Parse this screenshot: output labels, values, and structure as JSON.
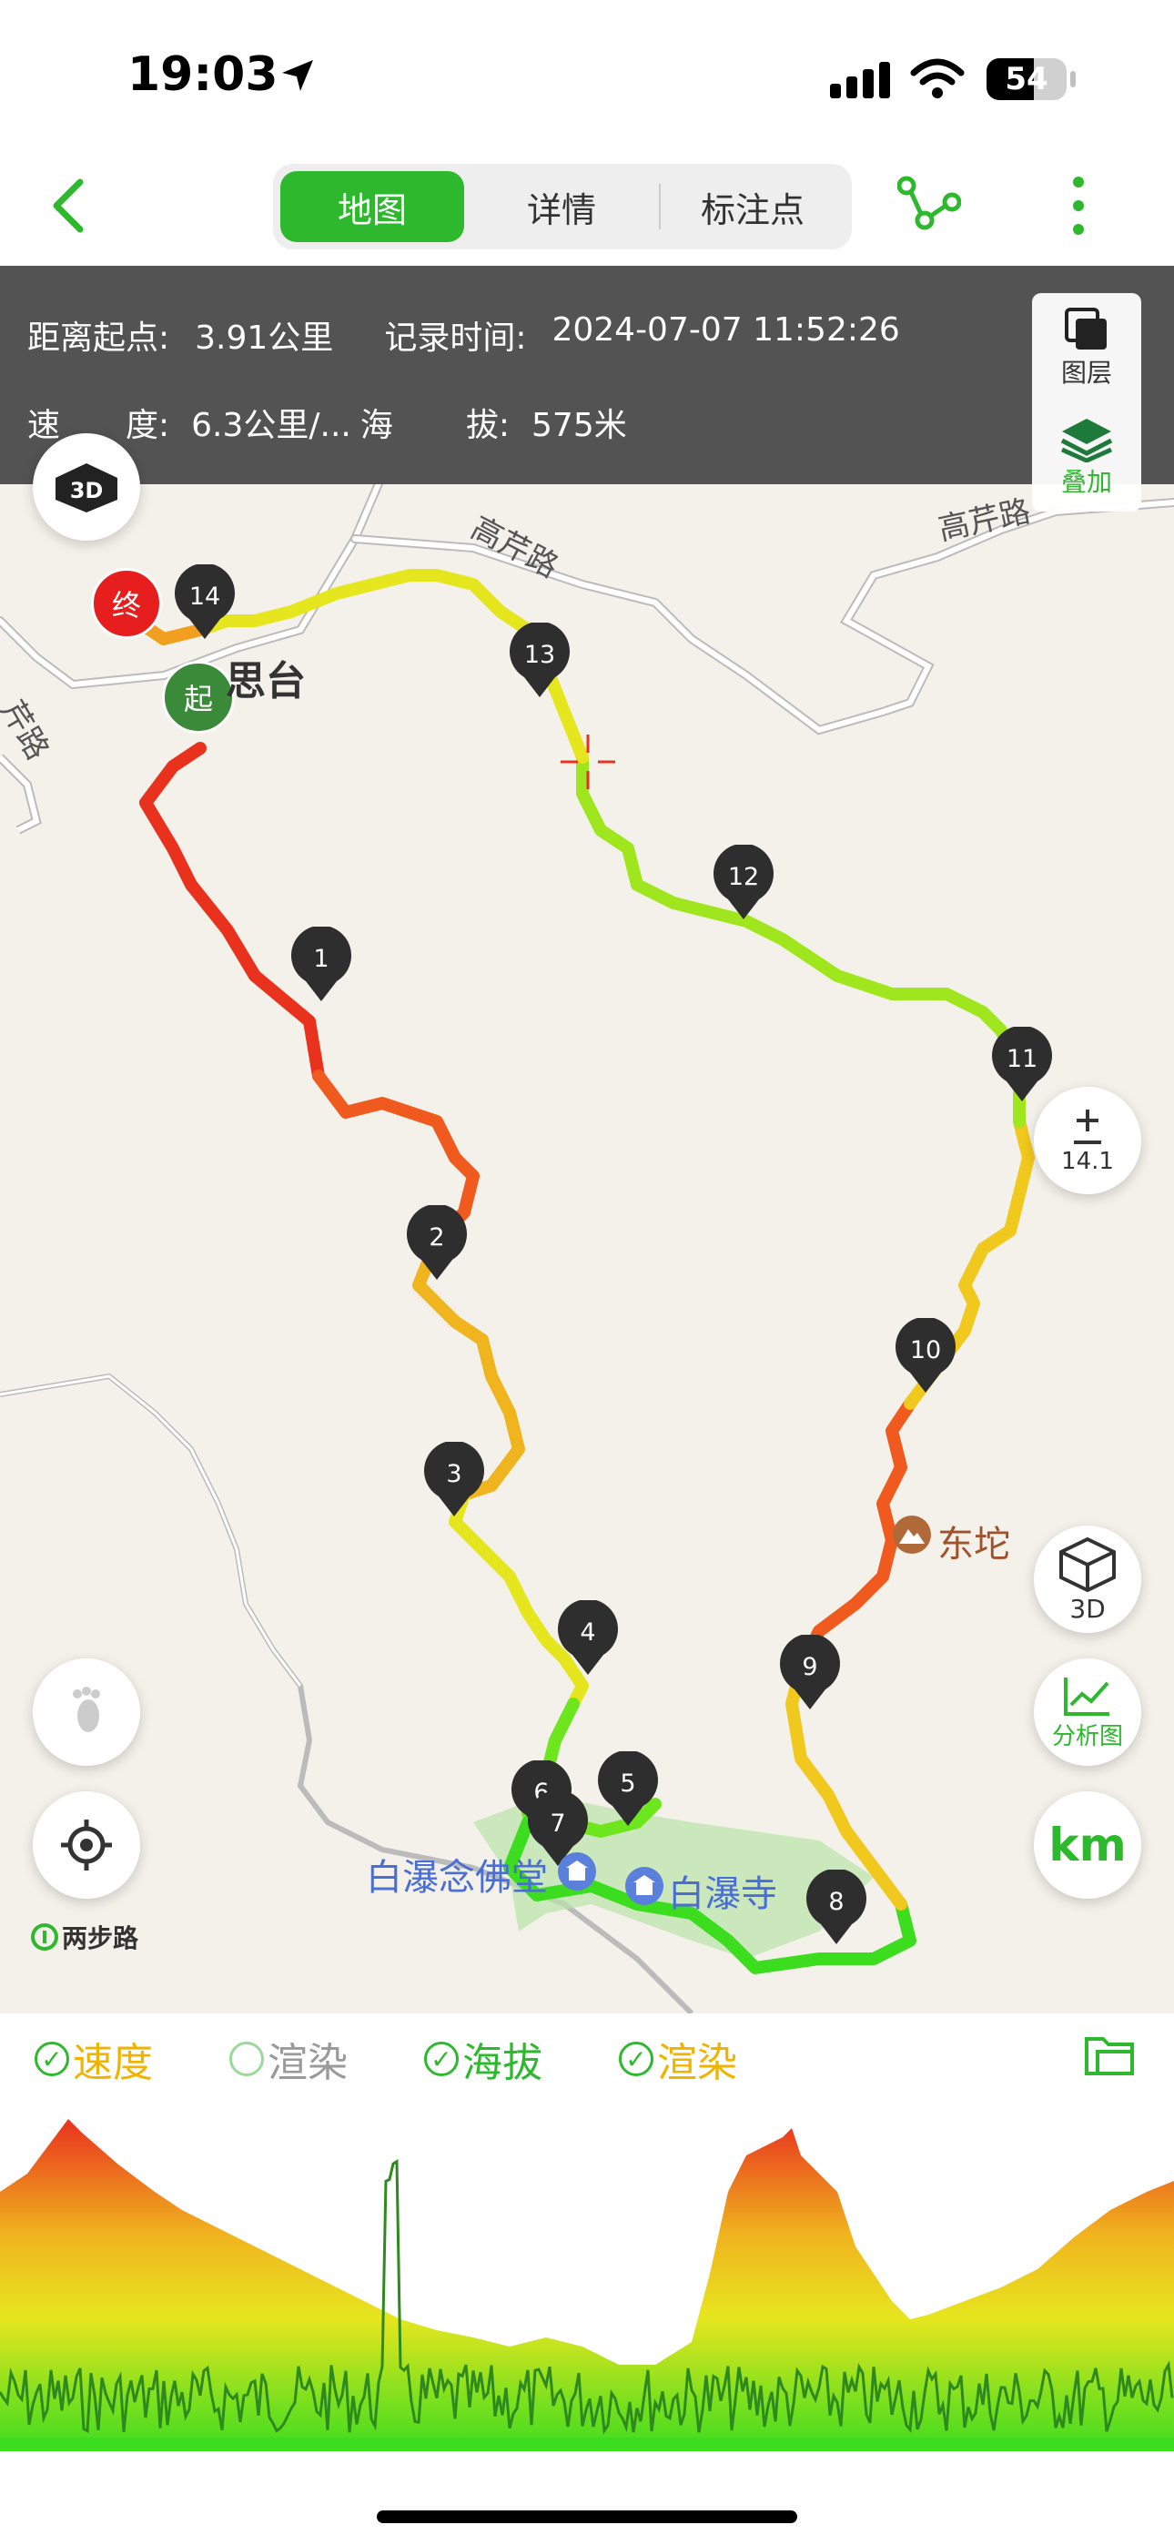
{
  "status_bar": {
    "time": "19:03",
    "battery": "54"
  },
  "nav": {
    "tabs": [
      {
        "label": "地图",
        "active": true
      },
      {
        "label": "详情",
        "active": false
      },
      {
        "label": "标注点",
        "active": false
      }
    ]
  },
  "info": {
    "distance_label": "距离起点:",
    "distance_value": "3.91公里",
    "record_time_label": "记录时间:",
    "record_time_value": "2024-07-07 11:52:26",
    "speed_label_1": "速",
    "speed_label_2": "度:",
    "speed_value": "6.3公里/...",
    "altitude_label_1": "海",
    "altitude_label_2": "拔:",
    "altitude_value": "575米"
  },
  "map": {
    "layers_label": "图层",
    "overlay_label": "叠加",
    "zoom_level": "14.1",
    "btn_3d_label": "3D",
    "analysis_label": "分析图",
    "unit_label": "km",
    "logo_text": "两步路",
    "road_labels": [
      "高芹路",
      "高芹路",
      "芹路"
    ],
    "place_labels": {
      "start_area": "思台",
      "peak": "东坨",
      "temple_hall": "白瀑念佛堂",
      "temple": "白瀑寺"
    },
    "start_marker": "起",
    "end_marker": "终",
    "waypoints": [
      "1",
      "2",
      "3",
      "4",
      "5",
      "6",
      "7",
      "8",
      "9",
      "10",
      "11",
      "12",
      "13",
      "14"
    ]
  },
  "legend": {
    "items": [
      {
        "label": "速度",
        "checked": true,
        "color": "#f0b400"
      },
      {
        "label": "渲染",
        "checked": false,
        "color": "#9a9a9a"
      },
      {
        "label": "海拔",
        "checked": true,
        "color": "#2db82d"
      },
      {
        "label": "渲染",
        "checked": true,
        "color": "#f0b400"
      }
    ]
  },
  "colors": {
    "brand_green": "#2db82d",
    "end_red": "#e61e1e",
    "track_red": "#e8321e",
    "track_yellow": "#e6e61e",
    "track_green": "#3cdc1e"
  }
}
